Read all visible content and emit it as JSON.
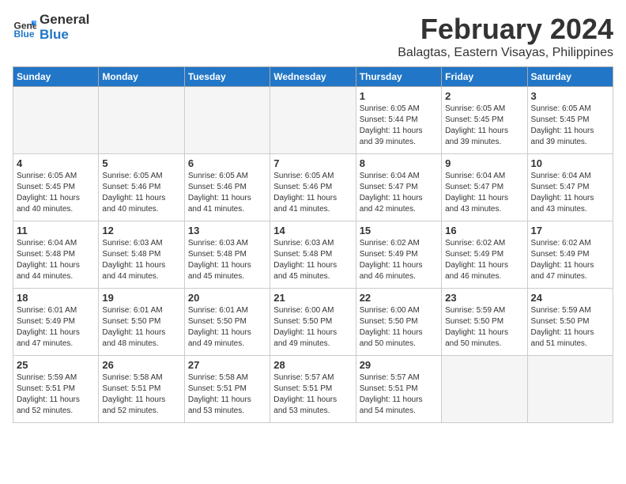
{
  "header": {
    "logo_line1": "General",
    "logo_line2": "Blue",
    "month": "February 2024",
    "location": "Balagtas, Eastern Visayas, Philippines"
  },
  "weekdays": [
    "Sunday",
    "Monday",
    "Tuesday",
    "Wednesday",
    "Thursday",
    "Friday",
    "Saturday"
  ],
  "weeks": [
    [
      {
        "day": "",
        "info": ""
      },
      {
        "day": "",
        "info": ""
      },
      {
        "day": "",
        "info": ""
      },
      {
        "day": "",
        "info": ""
      },
      {
        "day": "1",
        "info": "Sunrise: 6:05 AM\nSunset: 5:44 PM\nDaylight: 11 hours\nand 39 minutes."
      },
      {
        "day": "2",
        "info": "Sunrise: 6:05 AM\nSunset: 5:45 PM\nDaylight: 11 hours\nand 39 minutes."
      },
      {
        "day": "3",
        "info": "Sunrise: 6:05 AM\nSunset: 5:45 PM\nDaylight: 11 hours\nand 39 minutes."
      }
    ],
    [
      {
        "day": "4",
        "info": "Sunrise: 6:05 AM\nSunset: 5:45 PM\nDaylight: 11 hours\nand 40 minutes."
      },
      {
        "day": "5",
        "info": "Sunrise: 6:05 AM\nSunset: 5:46 PM\nDaylight: 11 hours\nand 40 minutes."
      },
      {
        "day": "6",
        "info": "Sunrise: 6:05 AM\nSunset: 5:46 PM\nDaylight: 11 hours\nand 41 minutes."
      },
      {
        "day": "7",
        "info": "Sunrise: 6:05 AM\nSunset: 5:46 PM\nDaylight: 11 hours\nand 41 minutes."
      },
      {
        "day": "8",
        "info": "Sunrise: 6:04 AM\nSunset: 5:47 PM\nDaylight: 11 hours\nand 42 minutes."
      },
      {
        "day": "9",
        "info": "Sunrise: 6:04 AM\nSunset: 5:47 PM\nDaylight: 11 hours\nand 43 minutes."
      },
      {
        "day": "10",
        "info": "Sunrise: 6:04 AM\nSunset: 5:47 PM\nDaylight: 11 hours\nand 43 minutes."
      }
    ],
    [
      {
        "day": "11",
        "info": "Sunrise: 6:04 AM\nSunset: 5:48 PM\nDaylight: 11 hours\nand 44 minutes."
      },
      {
        "day": "12",
        "info": "Sunrise: 6:03 AM\nSunset: 5:48 PM\nDaylight: 11 hours\nand 44 minutes."
      },
      {
        "day": "13",
        "info": "Sunrise: 6:03 AM\nSunset: 5:48 PM\nDaylight: 11 hours\nand 45 minutes."
      },
      {
        "day": "14",
        "info": "Sunrise: 6:03 AM\nSunset: 5:48 PM\nDaylight: 11 hours\nand 45 minutes."
      },
      {
        "day": "15",
        "info": "Sunrise: 6:02 AM\nSunset: 5:49 PM\nDaylight: 11 hours\nand 46 minutes."
      },
      {
        "day": "16",
        "info": "Sunrise: 6:02 AM\nSunset: 5:49 PM\nDaylight: 11 hours\nand 46 minutes."
      },
      {
        "day": "17",
        "info": "Sunrise: 6:02 AM\nSunset: 5:49 PM\nDaylight: 11 hours\nand 47 minutes."
      }
    ],
    [
      {
        "day": "18",
        "info": "Sunrise: 6:01 AM\nSunset: 5:49 PM\nDaylight: 11 hours\nand 47 minutes."
      },
      {
        "day": "19",
        "info": "Sunrise: 6:01 AM\nSunset: 5:50 PM\nDaylight: 11 hours\nand 48 minutes."
      },
      {
        "day": "20",
        "info": "Sunrise: 6:01 AM\nSunset: 5:50 PM\nDaylight: 11 hours\nand 49 minutes."
      },
      {
        "day": "21",
        "info": "Sunrise: 6:00 AM\nSunset: 5:50 PM\nDaylight: 11 hours\nand 49 minutes."
      },
      {
        "day": "22",
        "info": "Sunrise: 6:00 AM\nSunset: 5:50 PM\nDaylight: 11 hours\nand 50 minutes."
      },
      {
        "day": "23",
        "info": "Sunrise: 5:59 AM\nSunset: 5:50 PM\nDaylight: 11 hours\nand 50 minutes."
      },
      {
        "day": "24",
        "info": "Sunrise: 5:59 AM\nSunset: 5:50 PM\nDaylight: 11 hours\nand 51 minutes."
      }
    ],
    [
      {
        "day": "25",
        "info": "Sunrise: 5:59 AM\nSunset: 5:51 PM\nDaylight: 11 hours\nand 52 minutes."
      },
      {
        "day": "26",
        "info": "Sunrise: 5:58 AM\nSunset: 5:51 PM\nDaylight: 11 hours\nand 52 minutes."
      },
      {
        "day": "27",
        "info": "Sunrise: 5:58 AM\nSunset: 5:51 PM\nDaylight: 11 hours\nand 53 minutes."
      },
      {
        "day": "28",
        "info": "Sunrise: 5:57 AM\nSunset: 5:51 PM\nDaylight: 11 hours\nand 53 minutes."
      },
      {
        "day": "29",
        "info": "Sunrise: 5:57 AM\nSunset: 5:51 PM\nDaylight: 11 hours\nand 54 minutes."
      },
      {
        "day": "",
        "info": ""
      },
      {
        "day": "",
        "info": ""
      }
    ]
  ]
}
